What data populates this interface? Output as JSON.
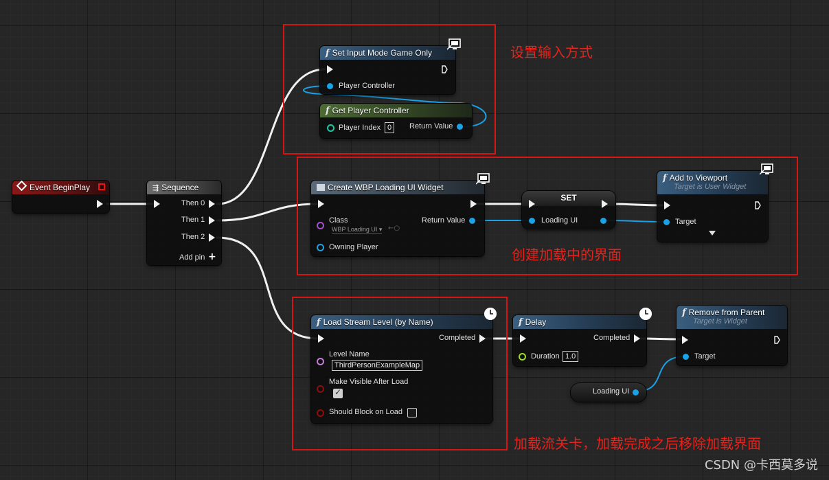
{
  "nodes": {
    "event_begin_play": {
      "title": "Event BeginPlay"
    },
    "sequence": {
      "title": "Sequence",
      "outputs": [
        "Then 0",
        "Then 1",
        "Then 2"
      ],
      "add_pin": "Add pin"
    },
    "set_input_mode": {
      "title": "Set Input Mode Game Only",
      "pin_player_controller": "Player Controller"
    },
    "get_player_controller": {
      "title": "Get Player Controller",
      "pin_player_index": "Player Index",
      "player_index_value": "0",
      "pin_return": "Return Value"
    },
    "create_widget": {
      "title": "Create WBP Loading UI Widget",
      "pin_class": "Class",
      "class_value": "WBP Loading UI",
      "pin_return": "Return Value",
      "pin_owning_player": "Owning Player"
    },
    "set_var": {
      "title": "SET",
      "pin_loading_ui": "Loading UI"
    },
    "add_to_viewport": {
      "title": "Add to Viewport",
      "subtitle": "Target is User Widget",
      "pin_target": "Target"
    },
    "load_stream_level": {
      "title": "Load Stream Level (by Name)",
      "pin_completed": "Completed",
      "pin_level_name": "Level Name",
      "level_name_value": "ThirdPersonExampleMap",
      "pin_make_visible": "Make Visible After Load",
      "make_visible_checked": true,
      "pin_should_block": "Should Block on Load",
      "should_block_checked": false
    },
    "delay": {
      "title": "Delay",
      "pin_completed": "Completed",
      "pin_duration": "Duration",
      "duration_value": "1.0"
    },
    "remove_from_parent": {
      "title": "Remove from Parent",
      "subtitle": "Target is Widget",
      "pin_target": "Target"
    },
    "loading_ui_getter": {
      "label": "Loading UI"
    }
  },
  "annotations": {
    "set_input_mode": "设置输入方式",
    "create_ui": "创建加载中的界面",
    "load_level": "加载流关卡，加载完成之后移除加载界面"
  },
  "watermark": "CSDN @卡西莫多说",
  "colors": {
    "background": "#262626",
    "annotation_red": "#d71515",
    "object_pin": "#1aa1e6",
    "exec_wire": "#f0f0f0"
  }
}
